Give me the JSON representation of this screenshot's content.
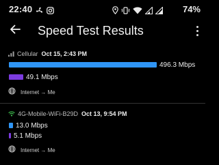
{
  "colors": {
    "background": "#000000",
    "download_bar": "#2f95f5",
    "upload_bar": "#7c3be0",
    "wifi_icon": "#3fbf4f"
  },
  "status_bar": {
    "time": "22:40",
    "battery": "74%",
    "left_icons": [
      "fan-icon",
      "instagram-icon"
    ],
    "right_icons": [
      "location-icon",
      "vibrate-icon",
      "wifi-icon",
      "signal-icon",
      "signal-icon"
    ]
  },
  "app_bar": {
    "title": "Speed Test Results",
    "back_icon": "arrow-left-icon",
    "more_icon": "more-vertical-icon"
  },
  "results": [
    {
      "network_icon": "cellular-signal-icon",
      "network": "Cellular",
      "timestamp": "Oct 15, 2:43 PM",
      "download": {
        "value": 496.3,
        "label": "496.3 Mbps"
      },
      "upload": {
        "value": 49.1,
        "label": "49.1 Mbps"
      },
      "route_icon": "globe-icon",
      "route": "Internet → Me"
    },
    {
      "network_icon": "wifi-icon",
      "network": "4G-Mobile-WiFi-B29D",
      "timestamp": "Oct 13, 9:54 PM",
      "download": {
        "value": 13.0,
        "label": "13.0 Mbps"
      },
      "upload": {
        "value": 5.1,
        "label": "5.1 Mbps"
      },
      "route_icon": "globe-icon",
      "route": "Internet → Me"
    }
  ]
}
